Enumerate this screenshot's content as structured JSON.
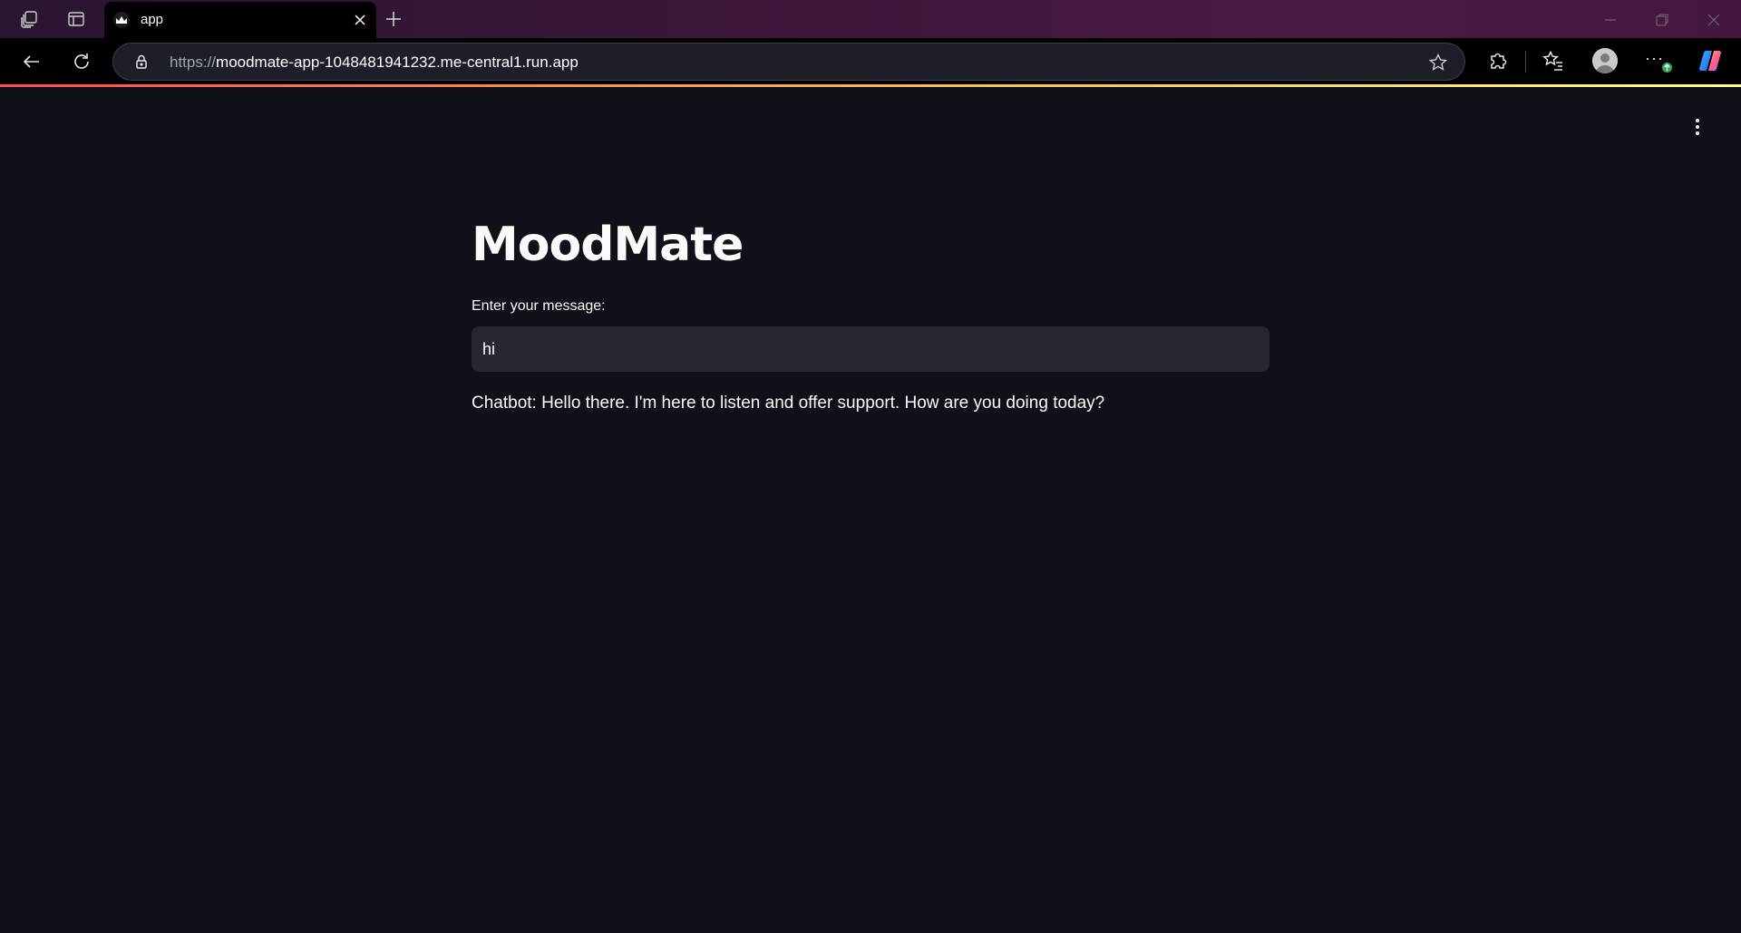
{
  "browser": {
    "tab": {
      "title": "app"
    },
    "address_bar": {
      "protocol": "https://",
      "host": "moodmate-app-1048481941232.me-central1.run.app"
    },
    "icons": {
      "workspaces": "workspaces-icon",
      "tab_actions": "tab-actions-icon",
      "new_tab": "plus-icon",
      "back": "back-arrow-icon",
      "refresh": "refresh-icon",
      "lock": "lock-icon",
      "favorite": "star-icon",
      "extensions": "puzzle-icon",
      "favorites": "favorites-icon",
      "profile": "avatar-icon",
      "more": "ellipsis-icon",
      "copilot": "copilot-icon"
    },
    "more_label": "···",
    "accent_colors": [
      "#ff4b4b",
      "#ffbd45",
      "#fffd80"
    ]
  },
  "app": {
    "title": "MoodMate",
    "input_label": "Enter your message:",
    "input_value": "hi",
    "response": "Chatbot: Hello there. I'm here to listen and offer support. How are you doing today?",
    "menu_icon": "vertical-dots-icon",
    "colors": {
      "background": "#0e1117",
      "text": "#fafafa",
      "input_bg": "#262730"
    }
  }
}
